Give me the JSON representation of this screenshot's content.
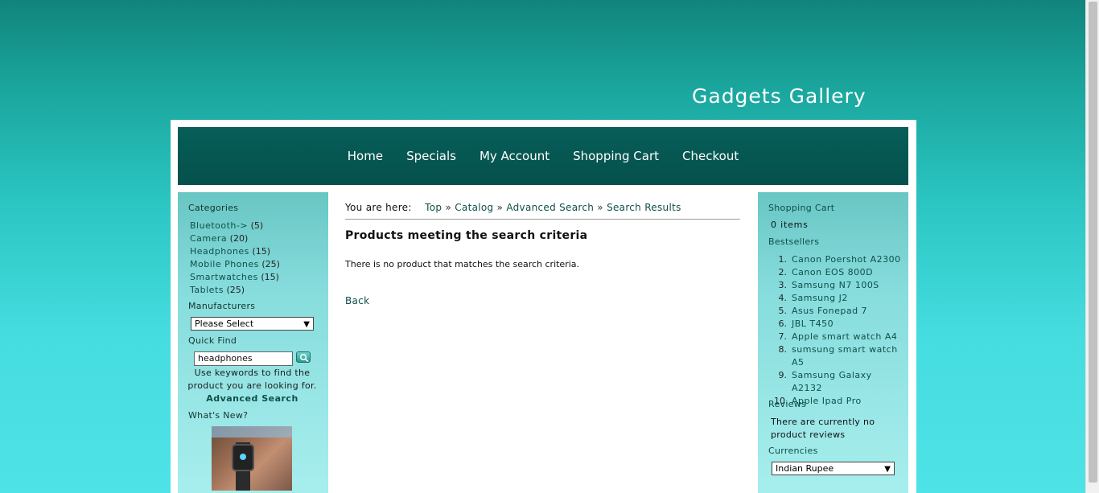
{
  "site": {
    "title": "Gadgets Gallery"
  },
  "nav": {
    "items": [
      "Home",
      "Specials",
      "My Account",
      "Shopping Cart",
      "Checkout"
    ]
  },
  "left": {
    "categories_title": "Categories",
    "categories": [
      {
        "name": "Bluetooth->",
        "count": "(5)"
      },
      {
        "name": "Camera",
        "count": "(20)"
      },
      {
        "name": "Headphones",
        "count": "(15)"
      },
      {
        "name": "Mobile Phones",
        "count": "(25)"
      },
      {
        "name": "Smartwatches",
        "count": "(15)"
      },
      {
        "name": "Tablets",
        "count": "(25)"
      }
    ],
    "manufacturers_title": "Manufacturers",
    "manufacturers_selected": "Please Select",
    "quickfind_title": "Quick Find",
    "search_value": "headphones",
    "help_text": "Use keywords to find the product you are looking for.",
    "advanced_search": "Advanced Search",
    "whats_new_title": "What's New?"
  },
  "main": {
    "breadcrumb_prefix": "You are here:",
    "breadcrumb": [
      "Top",
      "Catalog",
      "Advanced Search",
      "Search Results"
    ],
    "breadcrumb_separator": "»",
    "heading": "Products meeting the search criteria",
    "message": "There is no product that matches the search criteria.",
    "back_label": "Back"
  },
  "right": {
    "cart_title": "Shopping Cart",
    "cart_items": "0 items",
    "bestsellers_title": "Bestsellers",
    "bestsellers": [
      "Canon Poershot A2300",
      "Canon EOS 800D",
      "Samsung N7 100S",
      "Samsung J2",
      "Asus Fonepad 7",
      "JBL T450",
      "Apple smart watch A4",
      "sumsung smart watch A5",
      "Samsung Galaxy A2132",
      "Apple Ipad Pro"
    ],
    "reviews_title": "Reviews",
    "reviews_text": "There are currently no product reviews",
    "currencies_title": "Currencies",
    "currency_selected": "Indian Rupee"
  },
  "colors": {
    "nav_bg": "#05504c",
    "link": "#0f4f4a",
    "sidebar_bg": "#86dcdc",
    "background": "#2cc7c4"
  },
  "icons": {
    "search": "search-icon",
    "chevron": "chevron-down-icon"
  }
}
